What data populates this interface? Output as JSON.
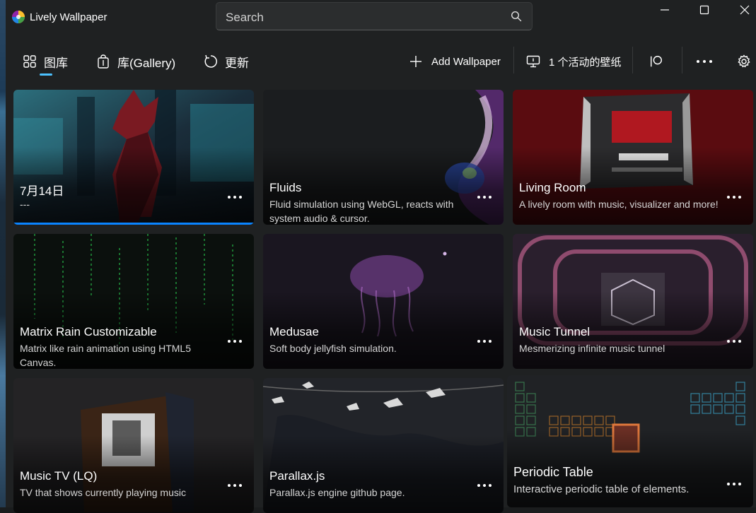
{
  "window": {
    "title": "Lively Wallpaper",
    "logo_icon": "lively-logo-icon",
    "controls": [
      "minimize-icon",
      "maximize-icon",
      "close-icon"
    ]
  },
  "search": {
    "placeholder": "Search",
    "icon": "search-icon"
  },
  "nav": {
    "items": [
      {
        "label": "图库",
        "icon": "grid-icon",
        "selected": true
      },
      {
        "label": "库(Gallery)",
        "icon": "bag-icon",
        "selected": false
      },
      {
        "label": "更新",
        "icon": "refresh-icon",
        "selected": false
      }
    ],
    "accent": "#4cc2ff"
  },
  "commands": {
    "add_wallpaper": {
      "label": "Add Wallpaper",
      "icon": "plus-icon"
    },
    "active_wallpapers": {
      "label": "1 个活动的壁纸",
      "icon": "monitor-icon"
    },
    "patreon_icon": "patreon-icon",
    "more_icon": "more-icon",
    "settings_icon": "gear-icon"
  },
  "wallpapers": [
    {
      "title": "7月14日",
      "description": "---",
      "selected": true
    },
    {
      "title": "Fluids",
      "description": "Fluid simulation using WebGL, reacts with system audio & cursor."
    },
    {
      "title": "Living Room",
      "description": "A lively room with music, visualizer and more!"
    },
    {
      "title": "Matrix Rain Customizable",
      "description": "Matrix like rain animation using HTML5 Canvas."
    },
    {
      "title": "Medusae",
      "description": "Soft body jellyfish simulation."
    },
    {
      "title": "Music Tunnel",
      "description": "Mesmerizing infinite music tunnel"
    },
    {
      "title": "Music TV (LQ)",
      "description": "TV that shows currently playing music"
    },
    {
      "title": "Parallax.js",
      "description": "Parallax.js engine github page."
    },
    {
      "title": "Periodic Table",
      "description": "Interactive periodic table of elements."
    }
  ],
  "colors": {
    "selection": "#0a84ff",
    "background": "#1f2122"
  }
}
